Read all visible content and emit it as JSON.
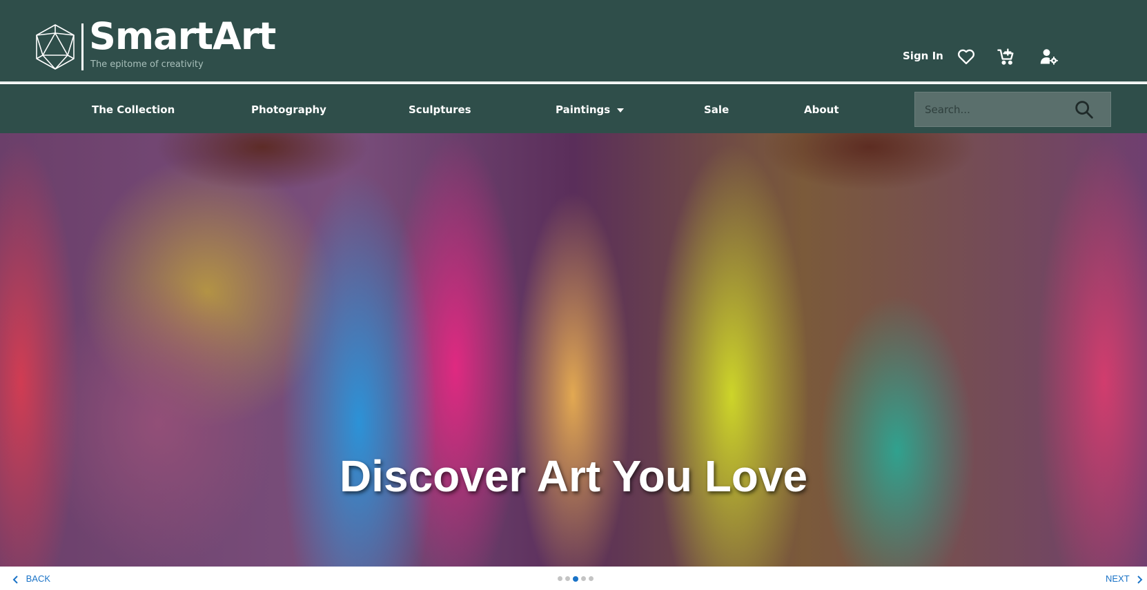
{
  "brand": {
    "name": "SmartArt",
    "tagline": "The epitome of creativity"
  },
  "header": {
    "sign_in_label": "Sign In",
    "icons": [
      "heart-icon",
      "cart-add-icon",
      "user-settings-icon"
    ]
  },
  "nav": {
    "items": [
      {
        "label": "The Collection"
      },
      {
        "label": "Photography"
      },
      {
        "label": "Sculptures"
      },
      {
        "label": "Paintings",
        "has_dropdown": true
      },
      {
        "label": "Sale"
      },
      {
        "label": "About"
      }
    ],
    "search": {
      "placeholder": "Search...",
      "value": ""
    }
  },
  "hero": {
    "title": "Discover Art You Love"
  },
  "carousel": {
    "back_label": "BACK",
    "next_label": "NEXT",
    "slide_count": 5,
    "active_slide": 2
  },
  "colors": {
    "header_bg": "#2f4e4a",
    "search_bg": "#5a6f6c",
    "link_blue": "#1a73c7",
    "dot_inactive": "#c4c4c4"
  }
}
